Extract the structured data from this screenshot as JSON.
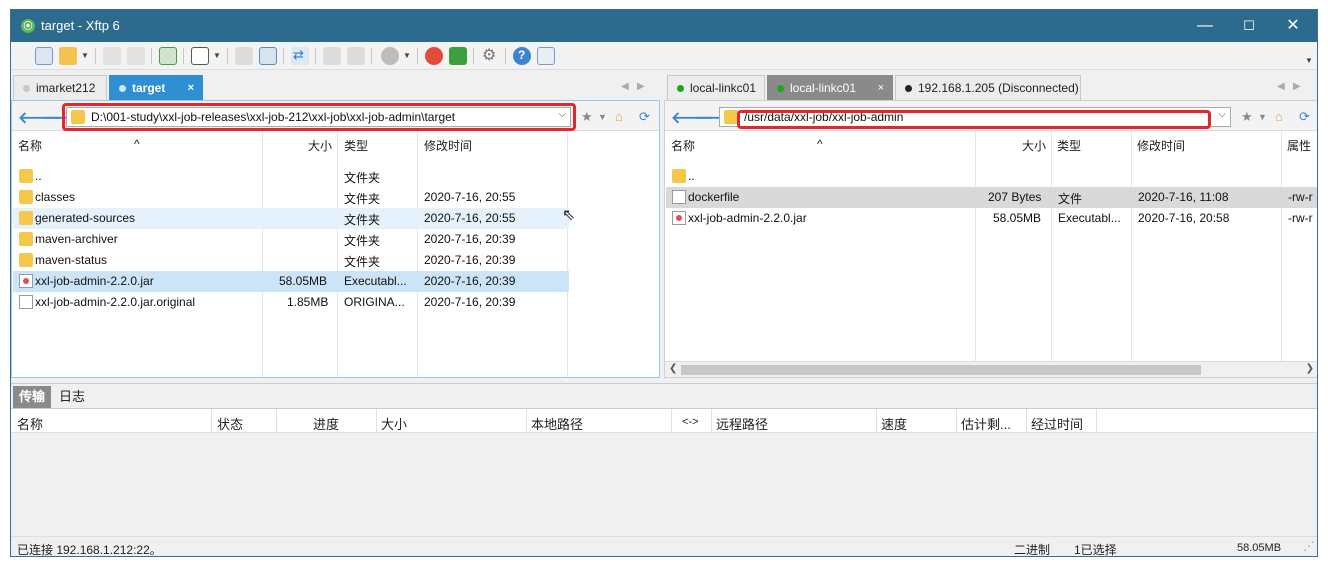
{
  "window": {
    "title": "target - Xftp 6"
  },
  "left_tabs": [
    {
      "label": "imarket212",
      "dot_color": "#c8c8c8"
    },
    {
      "label": "target",
      "dot_color": "#cfe6f7",
      "close": "×"
    }
  ],
  "right_tabs": [
    {
      "label": "local-linkc01",
      "dot_color": "#1aa81a"
    },
    {
      "label": "local-linkc01",
      "dot_color": "#1aa81a",
      "close": "×"
    },
    {
      "label": "192.168.1.205 (Disconnected)",
      "dot_color": "#222222"
    }
  ],
  "left_pane": {
    "path": "D:\\001-study\\xxl-job-releases\\xxl-job-212\\xxl-job\\xxl-job-admin\\target",
    "columns": {
      "name": "名称",
      "size": "大小",
      "type": "类型",
      "modified": "修改时间"
    },
    "rows": [
      {
        "icon": "folder-icon",
        "name": "..",
        "size": "",
        "type": "文件夹",
        "modified": ""
      },
      {
        "icon": "folder-icon",
        "name": "classes",
        "size": "",
        "type": "文件夹",
        "modified": "2020-7-16, 20:55"
      },
      {
        "icon": "folder-icon",
        "name": "generated-sources",
        "size": "",
        "type": "文件夹",
        "modified": "2020-7-16, 20:55"
      },
      {
        "icon": "folder-icon",
        "name": "maven-archiver",
        "size": "",
        "type": "文件夹",
        "modified": "2020-7-16, 20:39"
      },
      {
        "icon": "folder-icon",
        "name": "maven-status",
        "size": "",
        "type": "文件夹",
        "modified": "2020-7-16, 20:39"
      },
      {
        "icon": "jar-icon",
        "name": "xxl-job-admin-2.2.0.jar",
        "size": "58.05MB",
        "type": "Executabl...",
        "modified": "2020-7-16, 20:39"
      },
      {
        "icon": "file-icon",
        "name": "xxl-job-admin-2.2.0.jar.original",
        "size": "1.85MB",
        "type": "ORIGINA...",
        "modified": "2020-7-16, 20:39"
      }
    ]
  },
  "right_pane": {
    "path": "/usr/data/xxl-job/xxl-job-admin",
    "columns": {
      "name": "名称",
      "size": "大小",
      "type": "类型",
      "modified": "修改时间",
      "attr": "属性"
    },
    "rows": [
      {
        "icon": "folder-icon",
        "name": "..",
        "size": "",
        "type": "",
        "modified": "",
        "attr": ""
      },
      {
        "icon": "file-icon",
        "name": "dockerfile",
        "size": "207 Bytes",
        "type": "文件",
        "modified": "2020-7-16, 11:08",
        "attr": "-rw-r"
      },
      {
        "icon": "jar-icon",
        "name": "xxl-job-admin-2.2.0.jar",
        "size": "58.05MB",
        "type": "Executabl...",
        "modified": "2020-7-16, 20:58",
        "attr": "-rw-r"
      }
    ]
  },
  "transfer": {
    "tabs": [
      "传输",
      "日志"
    ],
    "columns": [
      "名称",
      "状态",
      "进度",
      "大小",
      "本地路径",
      "<->",
      "远程路径",
      "速度",
      "估计剩...",
      "经过时间"
    ]
  },
  "status": {
    "connection": "已连接 192.168.1.212:22。",
    "mode": "二进制",
    "selection": "1已选择",
    "size": "58.05MB"
  }
}
